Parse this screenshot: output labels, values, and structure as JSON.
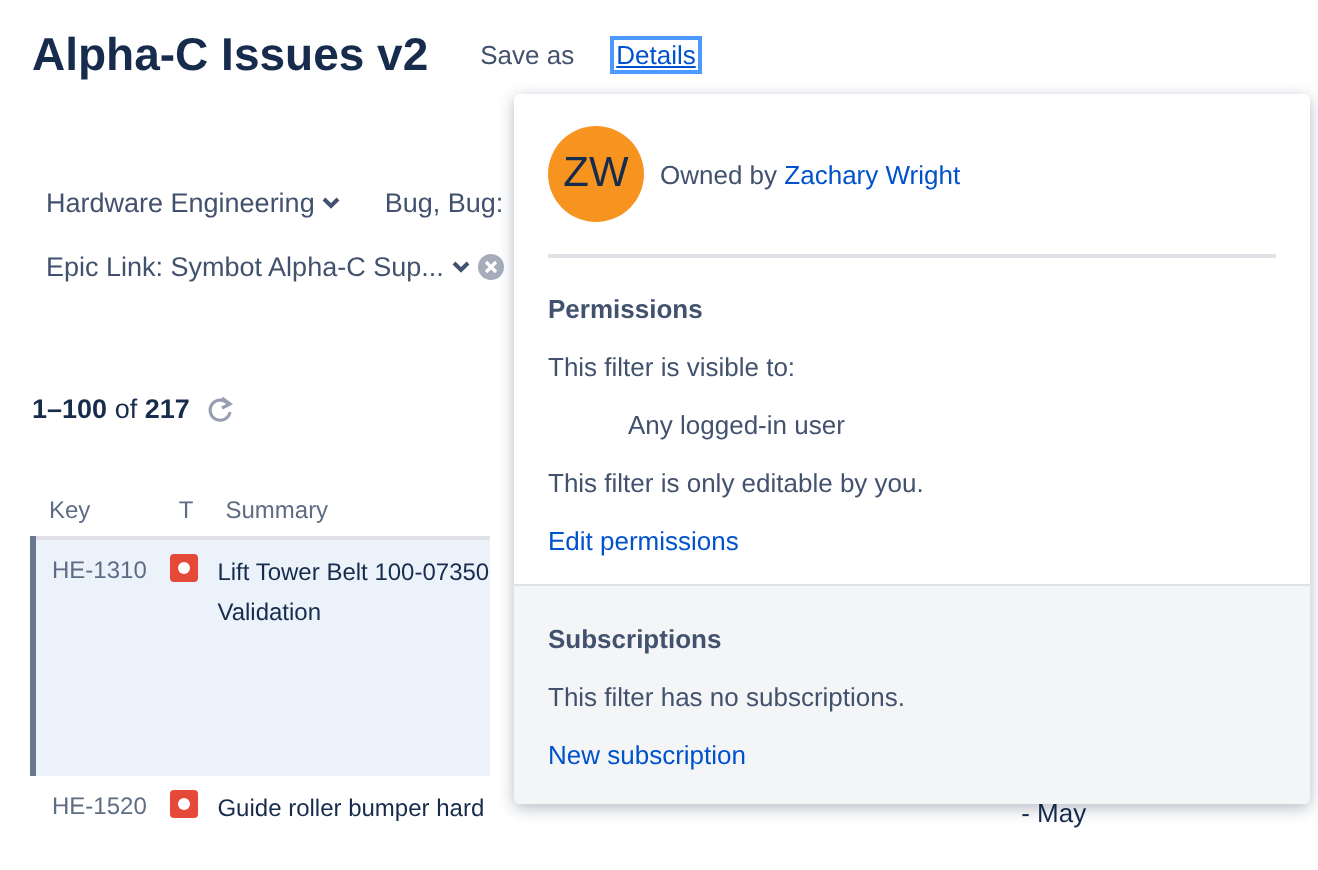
{
  "header": {
    "title": "Alpha-C Issues v2",
    "actions": [
      {
        "label": "Save as",
        "kind": "plain"
      },
      {
        "label": "Details",
        "kind": "link"
      }
    ]
  },
  "filters": [
    [
      {
        "label": "Hardware Engineering",
        "dropdown": true,
        "clearable": false
      },
      {
        "label": "Bug, Bug:",
        "dropdown": false,
        "clearable": false
      }
    ],
    [
      {
        "label": "Epic Link: Symbot Alpha-C Sup...",
        "dropdown": true,
        "clearable": true
      }
    ]
  ],
  "results": {
    "range": "1–100",
    "of": "of",
    "total": "217"
  },
  "table": {
    "columns": [
      "Key",
      "T",
      "Summary"
    ],
    "rows": [
      {
        "key": "HE-1310",
        "kind": "bug",
        "summary_lines": [
          "Lift Tower Belt 100-07350",
          "Validation"
        ],
        "selected": true
      },
      {
        "key": "HE-1520",
        "kind": "bug",
        "summary_lines": [
          "Guide roller bumper hard"
        ],
        "selected": false,
        "column_4": "- May"
      }
    ]
  },
  "details_popup": {
    "avatar_initials": "ZW",
    "owner_prefix": "Owned by",
    "owner": "Zachary Wright",
    "permissions": {
      "heading": "Permissions",
      "visible_to": "This filter is visible to:",
      "audience": "Any logged-in user",
      "editable": "This filter is only editable by you.",
      "link": "Edit permissions"
    },
    "subscriptions": {
      "heading": "Subscriptions",
      "status": "This filter has no subscriptions.",
      "link": "New subscription"
    }
  }
}
